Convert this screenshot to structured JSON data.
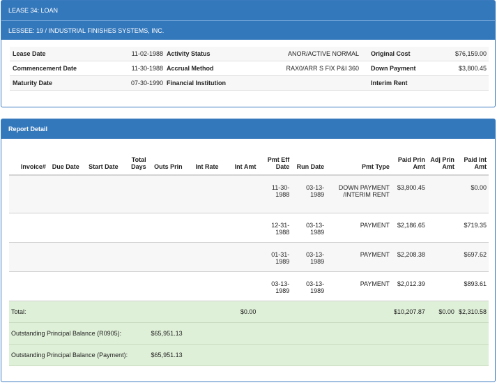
{
  "lease": {
    "title": "LEASE  34:  LOAN",
    "lessee": "LESSEE: 19 / INDUSTRIAL FINISHES SYSTEMS, INC."
  },
  "info": [
    {
      "l1": "Lease Date",
      "v1": "11-02-1988",
      "l2": "Activity Status",
      "v2": "ANOR/ACTIVE NORMAL",
      "l3": "Original Cost",
      "v3": "$76,159.00"
    },
    {
      "l1": "Commencement Date",
      "v1": "11-30-1988",
      "l2": "Accrual Method",
      "v2": "RAX0/ARR S FIX P&I 360",
      "l3": "Down Payment",
      "v3": "$3,800.45"
    },
    {
      "l1": "Maturity Date",
      "v1": "07-30-1990",
      "l2": "Financial Institution",
      "v2": "",
      "l3": "Interim Rent",
      "v3": ""
    }
  ],
  "report": {
    "title": "Report Detail",
    "columns": {
      "invoice": "Invoice#",
      "due_date": "Due Date",
      "start_date": "Start Date",
      "total_days": "Total Days",
      "outs_prin": "Outs Prin",
      "int_rate": "Int Rate",
      "int_amt": "Int Amt",
      "pmt_eff_date": "Pmt Eff Date",
      "run_date": "Run Date",
      "pmt_type": "Pmt Type",
      "paid_prin_amt": "Paid Prin Amt",
      "adj_prin_amt": "Adj Prin Amt",
      "paid_int_amt": "Paid Int Amt"
    },
    "rows": [
      {
        "pmt_eff_date": "11-30-1988",
        "run_date": "03-13-1989",
        "pmt_type": "DOWN PAYMENT /INTERIM RENT",
        "paid_prin_amt": "$3,800.45",
        "adj_prin_amt": "",
        "paid_int_amt": "$0.00"
      },
      {
        "pmt_eff_date": "12-31-1988",
        "run_date": "03-13-1989",
        "pmt_type": "PAYMENT",
        "paid_prin_amt": "$2,186.65",
        "adj_prin_amt": "",
        "paid_int_amt": "$719.35"
      },
      {
        "pmt_eff_date": "01-31-1989",
        "run_date": "03-13-1989",
        "pmt_type": "PAYMENT",
        "paid_prin_amt": "$2,208.38",
        "adj_prin_amt": "",
        "paid_int_amt": "$697.62"
      },
      {
        "pmt_eff_date": "03-13-1989",
        "run_date": "03-13-1989",
        "pmt_type": "PAYMENT",
        "paid_prin_amt": "$2,012.39",
        "adj_prin_amt": "",
        "paid_int_amt": "$893.61"
      }
    ],
    "total": {
      "label": "Total:",
      "int_amt": "$0.00",
      "paid_prin_amt": "$10,207.87",
      "adj_prin_amt": "$0.00",
      "paid_int_amt": "$2,310.58"
    },
    "balance_r0905": {
      "label": "Outstanding Principal Balance (R0905):",
      "value": "$65,951.13"
    },
    "balance_payment": {
      "label": "Outstanding Principal Balance (Payment):",
      "value": "$65,951.13"
    }
  }
}
